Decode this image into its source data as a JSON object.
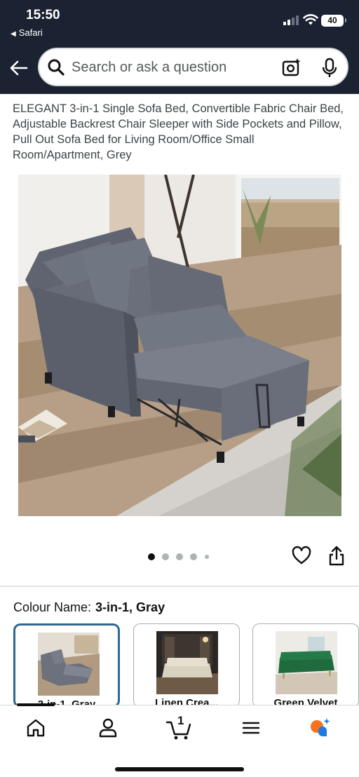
{
  "status_bar": {
    "time": "15:50",
    "back_app": "Safari",
    "battery": "40"
  },
  "search": {
    "placeholder": "Search or ask a question"
  },
  "product": {
    "title": "ELEGANT 3-in-1 Single Sofa Bed, Convertible Fabric Chair Bed, Adjustable Backrest Chair Sleeper with Side Pockets and Pillow, Pull Out Sofa Bed for Living Room/Office Small Room/Apartment, Grey",
    "image_count": 5,
    "image_index": 1
  },
  "colour": {
    "label": "Colour Name:",
    "selected": "3-in-1, Gray",
    "options": [
      {
        "label": "3-in-1, Gray"
      },
      {
        "label": "Linen Crea..."
      },
      {
        "label": "Green Velvet"
      }
    ]
  },
  "bottom_nav": {
    "cart_count": "1"
  },
  "colors": {
    "header_bg": "#1b2232",
    "selected_border": "#2e6791",
    "ai_orange": "#f7711e",
    "ai_blue": "#1f7be0"
  }
}
